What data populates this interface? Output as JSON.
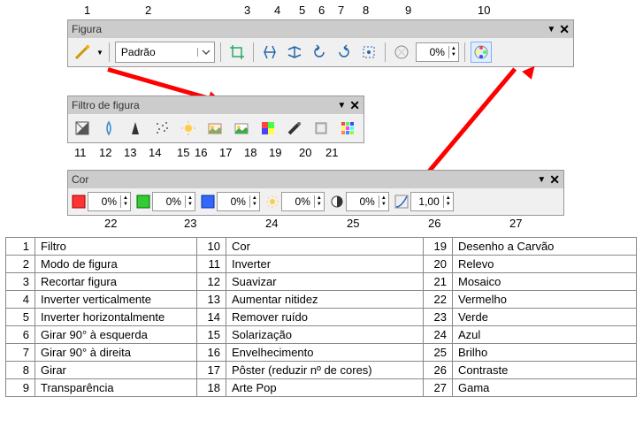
{
  "labels_top": {
    "1": "1",
    "2": "2",
    "3": "3",
    "4": "4",
    "5": "5",
    "6": "6",
    "7": "7",
    "8": "8",
    "9": "9",
    "10": "10"
  },
  "labels_mid": {
    "11": "11",
    "12": "12",
    "13": "13",
    "14": "14",
    "15": "15",
    "16": "16",
    "17": "17",
    "18": "18",
    "19": "19",
    "20": "20",
    "21": "21"
  },
  "labels_bot": {
    "22": "22",
    "23": "23",
    "24": "24",
    "25": "25",
    "26": "26",
    "27": "27"
  },
  "panel_figura": {
    "title": "Figura",
    "mode_value": "Padrão",
    "transparency": "0%"
  },
  "panel_filtro": {
    "title": "Filtro de figura"
  },
  "panel_cor": {
    "title": "Cor",
    "red": "0%",
    "green": "0%",
    "blue": "0%",
    "brightness": "0%",
    "contrast": "0%",
    "gamma": "1,00"
  },
  "table": [
    {
      "n1": "1",
      "t1": "Filtro",
      "n2": "10",
      "t2": "Cor",
      "n3": "19",
      "t3": "Desenho a Carvão"
    },
    {
      "n1": "2",
      "t1": "Modo de figura",
      "n2": "11",
      "t2": "Inverter",
      "n3": "20",
      "t3": "Relevo"
    },
    {
      "n1": "3",
      "t1": "Recortar figura",
      "n2": "12",
      "t2": "Suavizar",
      "n3": "21",
      "t3": "Mosaico"
    },
    {
      "n1": "4",
      "t1": "Inverter verticalmente",
      "n2": "13",
      "t2": "Aumentar nitidez",
      "n3": "22",
      "t3": "Vermelho"
    },
    {
      "n1": "5",
      "t1": "Inverter horizontalmente",
      "n2": "14",
      "t2": "Remover ruído",
      "n3": "23",
      "t3": "Verde"
    },
    {
      "n1": "6",
      "t1": "Girar 90° à esquerda",
      "n2": "15",
      "t2": "Solarização",
      "n3": "24",
      "t3": "Azul"
    },
    {
      "n1": "7",
      "t1": "Girar 90° à direita",
      "n2": "16",
      "t2": "Envelhecimento",
      "n3": "25",
      "t3": "Brilho"
    },
    {
      "n1": "8",
      "t1": "Girar",
      "n2": "17",
      "t2": "Pôster (reduzir nº de cores)",
      "n3": "26",
      "t3": "Contraste"
    },
    {
      "n1": "9",
      "t1": "Transparência",
      "n2": "18",
      "t2": "Arte Pop",
      "n3": "27",
      "t3": "Gama"
    }
  ]
}
